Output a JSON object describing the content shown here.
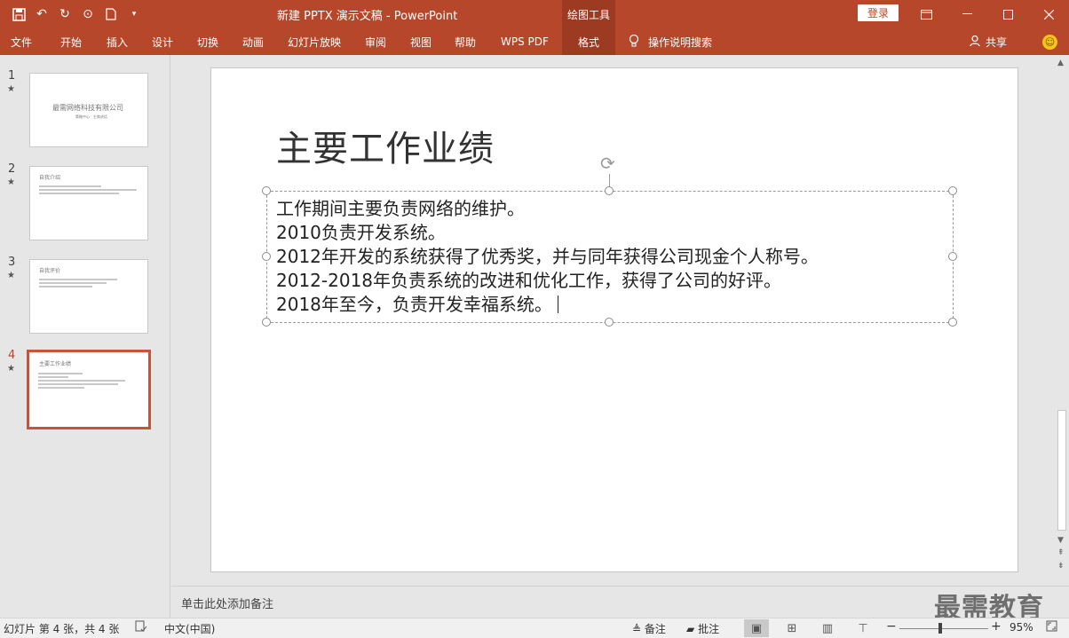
{
  "titlebar": {
    "document_title": "新建 PPTX 演示文稿  -  PowerPoint",
    "context_tab": "绘图工具",
    "login": "登录",
    "icons": [
      "save-icon",
      "undo-icon",
      "redo-icon",
      "present-icon",
      "new-icon",
      "customize-icon"
    ]
  },
  "ribbon": {
    "tabs": [
      "文件",
      "开始",
      "插入",
      "设计",
      "切换",
      "动画",
      "幻灯片放映",
      "审阅",
      "视图",
      "帮助",
      "WPS PDF",
      "格式"
    ],
    "active_tab": "格式",
    "search_hint": "操作说明搜索",
    "share": "共享"
  },
  "thumbnails": [
    {
      "number": "1",
      "star": "★",
      "title": "最需网络科技有限公司",
      "subtitle": "策略中心 · 主席讲话"
    },
    {
      "number": "2",
      "star": "★",
      "title": "自我介绍"
    },
    {
      "number": "3",
      "star": "★",
      "title": "自我评价"
    },
    {
      "number": "4",
      "star": "★",
      "title": "主要工作业绩"
    }
  ],
  "active_slide": 4,
  "slide": {
    "title": "主要工作业绩",
    "body_lines": [
      "工作期间主要负责网络的维护。",
      "2010负责开发系统。",
      "2012年开发的系统获得了优秀奖，并与同年获得公司现金个人称号。",
      "2012-2018年负责系统的改进和优化工作，获得了公司的好评。",
      "2018年至今，负责开发幸福系统。"
    ]
  },
  "notes": {
    "placeholder": "单击此处添加备注"
  },
  "watermark": "最需教育",
  "statusbar": {
    "slide_info": "幻灯片 第 4 张，共 4 张",
    "language": "中文(中国)",
    "notes_btn": "备注",
    "comments_btn": "批注",
    "zoom": "95%",
    "zoom_fraction": 0.95
  },
  "colors": {
    "accent": "#b7472a",
    "accent_dark": "#9c3a22"
  }
}
